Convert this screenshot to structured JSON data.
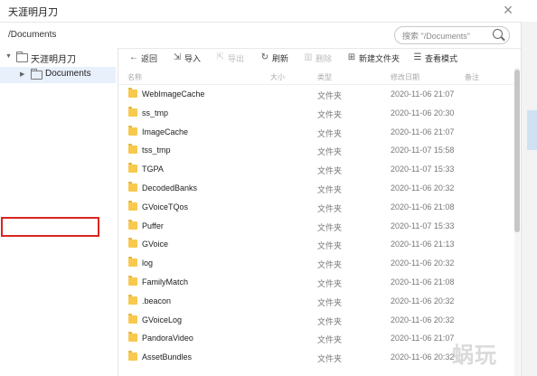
{
  "window": {
    "title": "天涯明月刀",
    "close_glyph": "×"
  },
  "pathbar": {
    "path": "/Documents",
    "search_placeholder": "搜索 \"/Documents\""
  },
  "sidebar": {
    "items": [
      {
        "arrow": "▼",
        "label": "天涯明月刀"
      },
      {
        "arrow": "▶",
        "label": "Documents"
      }
    ]
  },
  "toolbar": {
    "back": "返回",
    "import": "导入",
    "export": "导出",
    "refresh": "刷新",
    "delete": "删除",
    "new_folder": "新建文件夹",
    "view_mode": "查看模式"
  },
  "columns": {
    "name": "名称",
    "size": "大小",
    "type": "类型",
    "modified": "修改日期",
    "note": "备注"
  },
  "files": [
    {
      "name": "WebImageCache",
      "type": "文件夹",
      "date": "2020-11-06 21:07"
    },
    {
      "name": "ss_tmp",
      "type": "文件夹",
      "date": "2020-11-06 20:30"
    },
    {
      "name": "ImageCache",
      "type": "文件夹",
      "date": "2020-11-06 21:07"
    },
    {
      "name": "tss_tmp",
      "type": "文件夹",
      "date": "2020-11-07 15:58"
    },
    {
      "name": "TGPA",
      "type": "文件夹",
      "date": "2020-11-07 15:33"
    },
    {
      "name": "DecodedBanks",
      "type": "文件夹",
      "date": "2020-11-06 20:32"
    },
    {
      "name": "GVoiceTQos",
      "type": "文件夹",
      "date": "2020-11-06 21:08"
    },
    {
      "name": "Puffer",
      "type": "文件夹",
      "date": "2020-11-07 15:33"
    },
    {
      "name": "GVoice",
      "type": "文件夹",
      "date": "2020-11-06 21:13"
    },
    {
      "name": "log",
      "type": "文件夹",
      "date": "2020-11-06 20:32"
    },
    {
      "name": "FamilyMatch",
      "type": "文件夹",
      "date": "2020-11-06 21:08"
    },
    {
      "name": ".beacon",
      "type": "文件夹",
      "date": "2020-11-06 20:32"
    },
    {
      "name": "GVoiceLog",
      "type": "文件夹",
      "date": "2020-11-06 20:32"
    },
    {
      "name": "PandoraVideo",
      "type": "文件夹",
      "date": "2020-11-06 21:07"
    },
    {
      "name": "AssetBundles",
      "type": "文件夹",
      "date": "2020-11-06 20:32"
    }
  ],
  "watermark": "蜗玩",
  "highlight_color": "#d9251f"
}
